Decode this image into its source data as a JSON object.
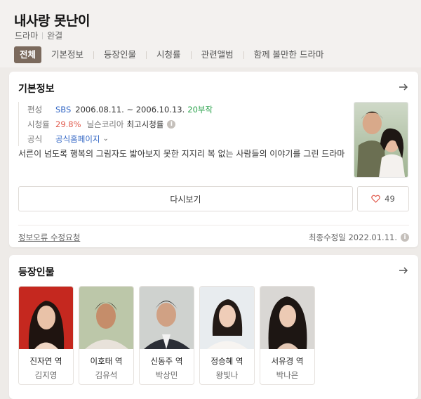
{
  "show": {
    "title": "내사랑 못난이",
    "genre": "드라마",
    "status": "완결"
  },
  "tabs": [
    {
      "label": "전체",
      "active": true
    },
    {
      "label": "기본정보"
    },
    {
      "label": "등장인물"
    },
    {
      "label": "시청률"
    },
    {
      "label": "관련앨범"
    },
    {
      "label": "함께 볼만한 드라마"
    }
  ],
  "basic_info": {
    "section_title": "기본정보",
    "broadcast_label": "편성",
    "channel": "SBS",
    "period": "2006.08.11. ~ 2006.10.13.",
    "episodes": "20부작",
    "rating_label": "시청률",
    "rating_value": "29.8%",
    "rating_source": "닐슨코리아",
    "rating_note": "최고시청률",
    "official_label": "공식",
    "official_link": "공식홈페이지",
    "description": "서른이 넘도록 행복의 그림자도 밟아보지 못한 지지리 복 없는 사람들의 이야기를 그린 드라마",
    "watch_button": "다시보기",
    "like_count": "49",
    "report_link": "정보오류 수정요청",
    "modified_text": "최종수정일 2022.01.11."
  },
  "cast_section": {
    "section_title": "등장인물",
    "members": [
      {
        "role": "진자연 역",
        "actor": "김지영"
      },
      {
        "role": "이호태 역",
        "actor": "김유석"
      },
      {
        "role": "신동주 역",
        "actor": "박상민"
      },
      {
        "role": "정승혜 역",
        "actor": "왕빛나"
      },
      {
        "role": "서유경 역",
        "actor": "박나은"
      }
    ]
  },
  "colors": {
    "active_tab": "#7b6a5d",
    "link_blue": "#3367c5",
    "episodes_green": "#2aa24b",
    "rating_red": "#e15a4c",
    "like_heart": "#e15a4c"
  }
}
